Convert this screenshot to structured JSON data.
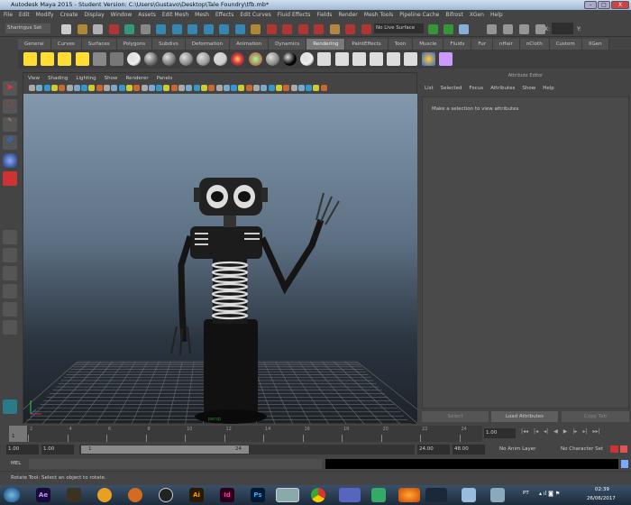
{
  "window": {
    "title": "Autodesk Maya 2015 - Student Version: C:\\Users\\Gustavo\\Desktop\\Tale Foundry\\tfb.mb*",
    "minimize": "–",
    "maximize": "□",
    "close": "X"
  },
  "menu": [
    "File",
    "Edit",
    "Modify",
    "Create",
    "Display",
    "Window",
    "Assets",
    "Edit Mesh",
    "Mesh",
    "Effects",
    "Edit Curves",
    "Fluid Effects",
    "Fields",
    "Render",
    "Mesh Tools",
    "Pipeline Cache",
    "Bifrost",
    "XGen",
    "Help"
  ],
  "status": {
    "menu_set": "Sharingus Set",
    "live_surface": "No Live Surface",
    "x_label": "X:",
    "y_label": "Y:"
  },
  "shelf": {
    "tabs": [
      "General",
      "Curves",
      "Surfaces",
      "Polygons",
      "Subdivs",
      "Deformation",
      "Animation",
      "Dynamics",
      "Rendering",
      "PaintEffects",
      "Toon",
      "Muscle",
      "Fluids",
      "Fur",
      "nHair",
      "nCloth",
      "Custom",
      "XGen"
    ],
    "active": "Rendering"
  },
  "panel": {
    "menu": [
      "View",
      "Shading",
      "Lighting",
      "Show",
      "Renderer",
      "Panels"
    ],
    "camera_label": "persp"
  },
  "attribute_editor": {
    "title": "Attribute Editor",
    "menu": [
      "List",
      "Selected",
      "Focus",
      "Attributes",
      "Show",
      "Help"
    ],
    "message": "Make a selection to view attributes",
    "buttons": [
      "Select",
      "Load Attributes",
      "Copy Tab"
    ]
  },
  "timeline": {
    "ticks": [
      "2",
      "4",
      "6",
      "8",
      "10",
      "12",
      "14",
      "16",
      "18",
      "20",
      "22",
      "24"
    ],
    "current_frame": "1",
    "current_time": "1.00"
  },
  "range": {
    "start": "1.00",
    "playback_start": "1.00",
    "slider_start": "1",
    "slider_end": "24",
    "playback_end": "24.00",
    "end": "48.00",
    "anim_layer": "No Anim Layer",
    "character_set": "No Character Set"
  },
  "command_line": {
    "label": "MEL"
  },
  "help_line": "Rotate Tool: Select an object to rotate.",
  "taskbar": {
    "apps": [
      "Ae",
      "Ai",
      "Id",
      "Ps"
    ],
    "language": "PT",
    "time": "02:39",
    "date": "26/06/2017"
  }
}
